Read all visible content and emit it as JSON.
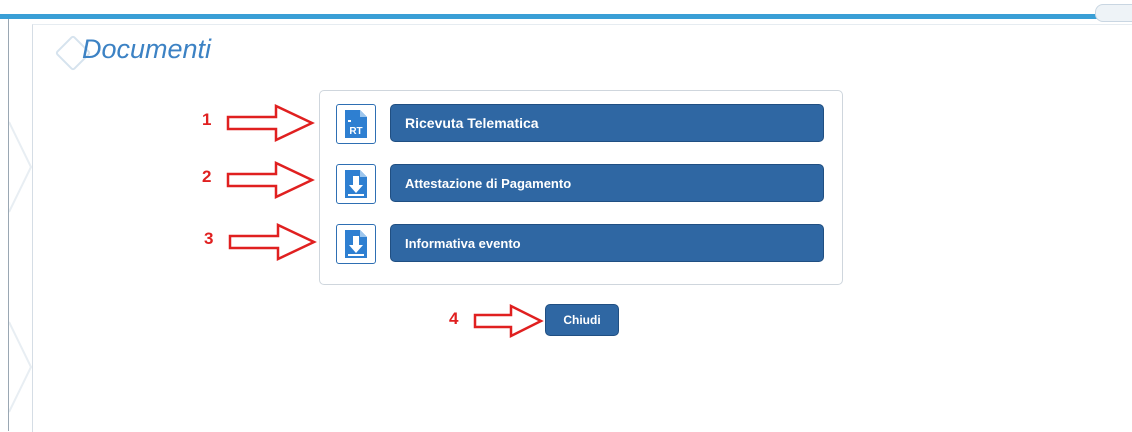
{
  "page": {
    "title": "Documenti"
  },
  "documents": [
    {
      "label": "Ricevuta Telematica",
      "icon": "rt-receipt-icon",
      "annotation": "1"
    },
    {
      "label": "Attestazione di Pagamento",
      "icon": "download-document-icon",
      "annotation": "2"
    },
    {
      "label": "Informativa evento",
      "icon": "download-document-icon",
      "annotation": "3"
    }
  ],
  "close_button": {
    "label": "Chiudi",
    "annotation": "4"
  },
  "icon_text": {
    "rt": "RT"
  },
  "colors": {
    "accent_bar": "#3a9fd6",
    "button": "#2f67a3",
    "title": "#3c82c4",
    "annotation": "#e02020"
  }
}
